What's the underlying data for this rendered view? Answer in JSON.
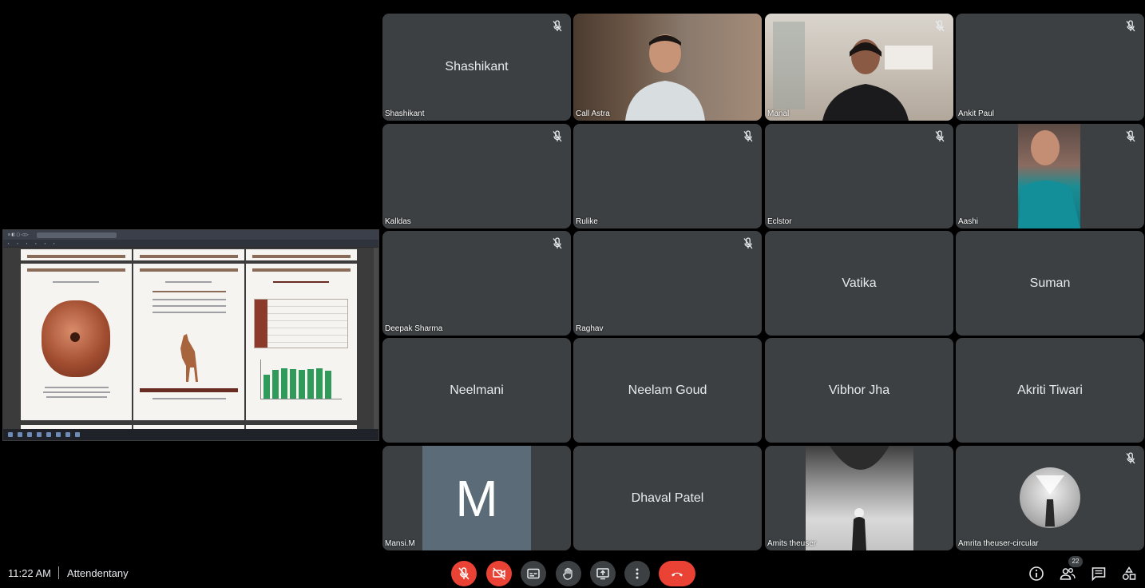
{
  "tiles": [
    {
      "name": "Shashikant",
      "center": "Shashikant",
      "muted": true
    },
    {
      "name": "Call Astra",
      "muted": false
    },
    {
      "name": "Manal",
      "muted": true
    },
    {
      "name": "Ankit Paul",
      "muted": true
    },
    {
      "name": "Kalldas",
      "muted": true
    },
    {
      "name": "Rulike",
      "muted": true
    },
    {
      "name": "Eclstor",
      "muted": true
    },
    {
      "name": "Aashi",
      "muted": true
    },
    {
      "name": "Deepak Sharma",
      "muted": true
    },
    {
      "name": "Raghav",
      "muted": true
    },
    {
      "center": "Vatika"
    },
    {
      "center": "Suman"
    },
    {
      "center": "Neelmani"
    },
    {
      "center": "Neelam Goud"
    },
    {
      "center": "Vibhor Jha"
    },
    {
      "center": "Akriti Tiwari"
    },
    {
      "name": "Mansi.M",
      "initial": "M"
    },
    {
      "center": "Dhaval Patel"
    },
    {
      "name": "Amits theuser"
    },
    {
      "name": "Amrita theuser-circular",
      "muted": true
    }
  ],
  "bottombar": {
    "time": "11:22 AM",
    "meeting_name": "Attendentany",
    "participants_count": "22"
  },
  "colors": {
    "tile_bg": "#3c4043",
    "end_call": "#ea4335",
    "control_bg": "#3c4043"
  },
  "icons": {
    "mic_off": "mic-off-icon",
    "cam_off": "videocam-off-icon",
    "captions": "captions-icon",
    "raise_hand": "raise-hand-icon",
    "present": "present-screen-icon",
    "more": "more-vert-icon",
    "end_call": "call-end-icon",
    "info": "info-icon",
    "people": "people-icon",
    "chat": "chat-icon",
    "activities": "activities-icon"
  }
}
